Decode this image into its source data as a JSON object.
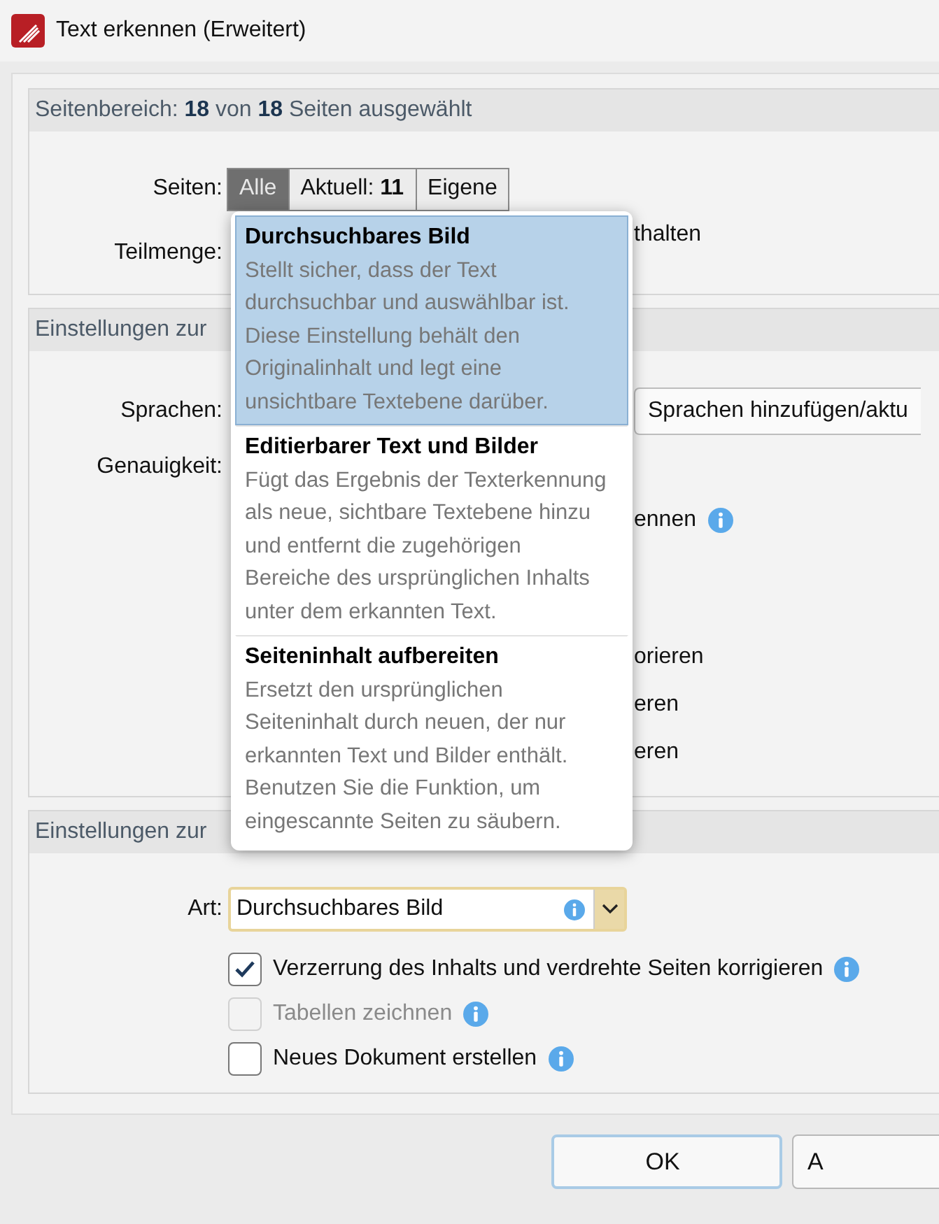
{
  "window": {
    "title": "Text erkennen (Erweitert)"
  },
  "page_range": {
    "header": "Seitenbereich: **18** von **18** Seiten ausgewählt",
    "pages_label": "Seiten:",
    "pages_options": [
      {
        "label": "Alle",
        "selected": true
      },
      {
        "label": "Aktuell: **11**",
        "selected": false
      },
      {
        "label": "Eigene",
        "selected": false
      }
    ],
    "subset_label": "Teilmenge:",
    "fragment": "thalten"
  },
  "recognition": {
    "header": "Einstellungen zur",
    "languages_label": "Sprachen:",
    "languages_button": "Sprachen hinzufügen/aktu",
    "accuracy_label": "Genauigkeit:",
    "fragments": [
      {
        "text": "ennen",
        "info": true
      },
      {
        "text": "orieren",
        "info": false
      },
      {
        "text": "eren",
        "info": false
      },
      {
        "text": "eren",
        "info": false
      }
    ]
  },
  "output": {
    "header": "Einstellungen zur",
    "type_label": "Art:",
    "type_value": "Durchsuchbares Bild",
    "options": [
      {
        "label": "Verzerrung des Inhalts und verdrehte Seiten korrigieren",
        "checked": true,
        "disabled": false
      },
      {
        "label": "Tabellen zeichnen",
        "checked": false,
        "disabled": true
      },
      {
        "label": "Neues Dokument erstellen",
        "checked": false,
        "disabled": false
      }
    ]
  },
  "type_menu": {
    "items": [
      {
        "title": "Durchsuchbares Bild",
        "description": "Stellt sicher, dass der Text durchsuchbar und auswählbar ist. Diese Einstellung behält den Originalinhalt und legt eine unsichtbare Textebene darüber.",
        "selected": true
      },
      {
        "title": "Editierbarer Text und Bilder",
        "description": "Fügt das Ergebnis der Texterkennung als neue, sichtbare Textebene hinzu und entfernt die zugehörigen Bereiche des ursprünglichen Inhalts unter dem erkannten Text.",
        "selected": false
      },
      {
        "title": "Seiteninhalt aufbereiten",
        "description": "Ersetzt den ursprünglichen Seiteninhalt durch neuen, der nur erkannten Text und Bilder enthält. Benutzen Sie die Funktion, um eingescannte Seiten zu säubern.",
        "selected": false
      }
    ]
  },
  "buttons": [
    {
      "label": "OK",
      "default": true
    },
    {
      "label": "A",
      "default": false
    }
  ]
}
